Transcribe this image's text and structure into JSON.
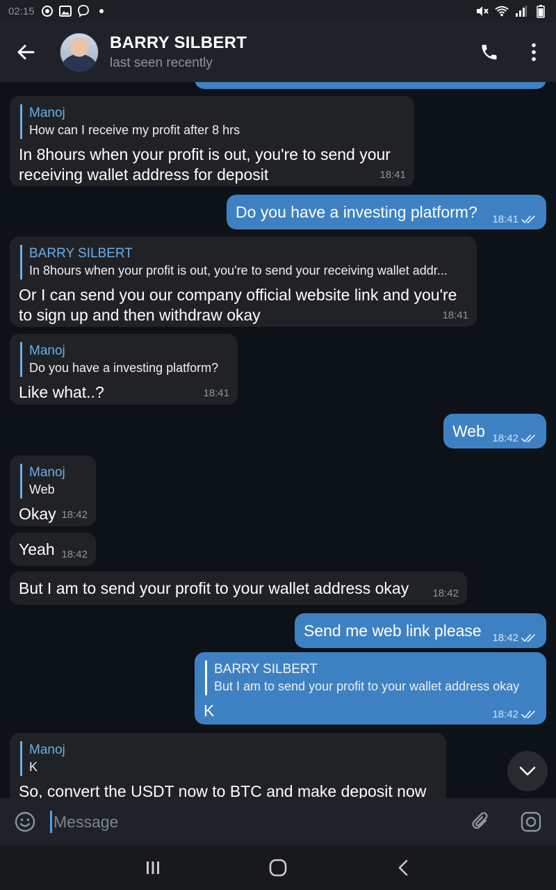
{
  "status_bar": {
    "time": "02:15"
  },
  "header": {
    "title": "BARRY SILBERT",
    "status": "last seen recently"
  },
  "messages": [
    {
      "direction": "in",
      "reply_name": "Manoj",
      "reply_text": "How can I receive my profit after 8 hrs",
      "text": "In 8hours when your profit is out, you're to send your receiving wallet address for deposit",
      "time": "18:41"
    },
    {
      "direction": "out",
      "text": "Do you have a investing platform?",
      "time": "18:41"
    },
    {
      "direction": "in",
      "reply_name": "BARRY SILBERT",
      "reply_text": "In 8hours when your profit is out, you're to send your receiving wallet addr...",
      "text": "Or I can send you our company official website link and you're to sign up and then withdraw okay",
      "time": "18:41"
    },
    {
      "direction": "in",
      "reply_name": "Manoj",
      "reply_text": "Do you have a investing platform?",
      "text": "Like what..?",
      "time": "18:41"
    },
    {
      "direction": "out",
      "text": "Web",
      "time": "18:42"
    },
    {
      "direction": "in",
      "reply_name": "Manoj",
      "reply_text": "Web",
      "text": "Okay",
      "time": "18:42"
    },
    {
      "direction": "in",
      "text": "Yeah",
      "time": "18:42"
    },
    {
      "direction": "in",
      "text": "But I am to send your profit to your wallet address okay",
      "time": "18:42"
    },
    {
      "direction": "out",
      "text": "Send me web link please",
      "time": "18:42"
    },
    {
      "direction": "out",
      "reply_name": "BARRY SILBERT",
      "reply_text": "But I am to send your profit to your wallet address okay",
      "text": "K",
      "time": "18:42"
    },
    {
      "direction": "in",
      "reply_name": "Manoj",
      "reply_text": "K",
      "text": "So, convert the USDT now to BTC and make deposit now",
      "time": ""
    }
  ],
  "input": {
    "placeholder": "Message"
  },
  "icons": {
    "back": "arrow-left-icon",
    "call": "phone-icon",
    "menu": "more-vertical-icon",
    "emoji": "emoji-icon",
    "attach": "paperclip-icon",
    "camera": "camera-icon",
    "scroll": "chevron-down-icon"
  },
  "colors": {
    "outgoing_bubble": "#3e81c3",
    "incoming_bubble": "#212226",
    "accent": "#6aaee9",
    "background": "#0d1118"
  }
}
